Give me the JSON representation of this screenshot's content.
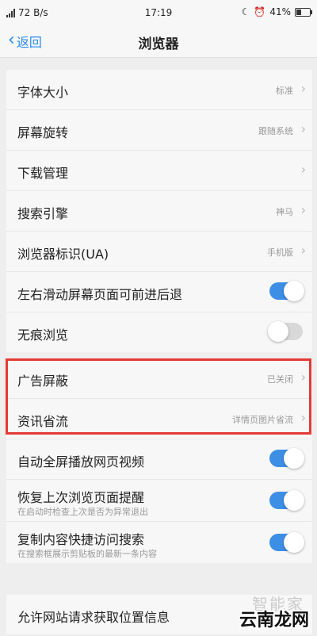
{
  "status_bar": {
    "network_speed": "72 B/s",
    "time": "17:19",
    "battery": "41%"
  },
  "nav": {
    "back_label": "返回",
    "title": "浏览器"
  },
  "group1": [
    {
      "label": "字体大小",
      "value": "标准"
    },
    {
      "label": "屏幕旋转",
      "value": "跟随系统"
    },
    {
      "label": "下载管理",
      "value": ""
    },
    {
      "label": "搜索引擎",
      "value": "神马"
    },
    {
      "label": "浏览器标识(UA)",
      "value": "手机版"
    },
    {
      "label": "左右滑动屏幕页面可前进后退",
      "toggle": true
    },
    {
      "label": "无痕浏览",
      "toggle": false
    }
  ],
  "group2": [
    {
      "label": "广告屏蔽",
      "value": "已关闭"
    },
    {
      "label": "资讯省流",
      "value": "详情页图片省流"
    },
    {
      "label": "自动全屏播放网页视频",
      "toggle": true
    },
    {
      "label": "恢复上次浏览页面提醒",
      "subtext": "在启动时检查上次是否为异常退出",
      "toggle": true
    },
    {
      "label": "复制内容快捷访问搜索",
      "subtext": "在搜索框展示剪贴板的最新一条内容",
      "toggle": true
    }
  ],
  "group3": [
    {
      "label": "允许网站请求获取位置信息"
    }
  ],
  "watermark": {
    "top": "智能家",
    "text": "云南龙网"
  },
  "colors": {
    "accent": "#3d8fe6",
    "highlight": "#e53935"
  }
}
